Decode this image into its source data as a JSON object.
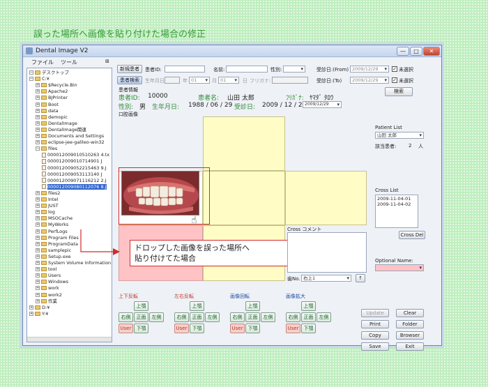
{
  "page_title": "誤った場所へ画像を貼り付けた場合の修正",
  "window": {
    "title": "Dental Image V2",
    "min": "—",
    "max": "□",
    "close": "✕"
  },
  "menu": [
    "ファイル",
    "ツール"
  ],
  "tree": [
    {
      "label": "デスクトップ",
      "depth": 0,
      "pm": "⊟",
      "type": "folder"
    },
    {
      "label": "C:¥",
      "depth": 0,
      "pm": "⊟",
      "type": "folder"
    },
    {
      "label": "$Recycle.Bin",
      "depth": 1,
      "pm": "⊞",
      "type": "folder"
    },
    {
      "label": "Apache2",
      "depth": 1,
      "pm": "⊞",
      "type": "folder"
    },
    {
      "label": "BJPrinter",
      "depth": 1,
      "pm": "⊞",
      "type": "folder"
    },
    {
      "label": "Boot",
      "depth": 1,
      "pm": "⊞",
      "type": "folder"
    },
    {
      "label": "data",
      "depth": 1,
      "pm": "⊞",
      "type": "folder"
    },
    {
      "label": "demopic",
      "depth": 1,
      "pm": "⊞",
      "type": "folder"
    },
    {
      "label": "DentalImage",
      "depth": 1,
      "pm": "⊞",
      "type": "folder"
    },
    {
      "label": "DentalImage関連",
      "depth": 1,
      "pm": "⊞",
      "type": "folder"
    },
    {
      "label": "Documents and Settings",
      "depth": 1,
      "pm": "⊞",
      "type": "folder"
    },
    {
      "label": "eclipse-jee-galileo-win32",
      "depth": 1,
      "pm": "⊞",
      "type": "folder"
    },
    {
      "label": "files",
      "depth": 1,
      "pm": "⊟",
      "type": "folder"
    },
    {
      "label": "000012009010510263 4.tx",
      "depth": 2,
      "pm": "",
      "type": "file"
    },
    {
      "label": "000012009010714901 J",
      "depth": 2,
      "pm": "",
      "type": "file"
    },
    {
      "label": "000012009052215463 9.J",
      "depth": 2,
      "pm": "",
      "type": "file"
    },
    {
      "label": "000012009053113140 J",
      "depth": 2,
      "pm": "",
      "type": "file"
    },
    {
      "label": "000012009071116212 2.J",
      "depth": 2,
      "pm": "",
      "type": "file"
    },
    {
      "label": "000012009080112076 8.J",
      "depth": 2,
      "pm": "",
      "type": "file",
      "selected": true
    },
    {
      "label": "files2",
      "depth": 1,
      "pm": "⊞",
      "type": "folder"
    },
    {
      "label": "Intel",
      "depth": 1,
      "pm": "⊞",
      "type": "folder"
    },
    {
      "label": "JUST",
      "depth": 1,
      "pm": "⊞",
      "type": "folder"
    },
    {
      "label": "log",
      "depth": 1,
      "pm": "⊞",
      "type": "folder"
    },
    {
      "label": "MSOCache",
      "depth": 1,
      "pm": "⊞",
      "type": "folder"
    },
    {
      "label": "MyWorks",
      "depth": 1,
      "pm": "⊞",
      "type": "folder"
    },
    {
      "label": "PerfLogs",
      "depth": 1,
      "pm": "⊞",
      "type": "folder"
    },
    {
      "label": "Program Files",
      "depth": 1,
      "pm": "⊞",
      "type": "folder"
    },
    {
      "label": "ProgramData",
      "depth": 1,
      "pm": "⊞",
      "type": "folder"
    },
    {
      "label": "samplepic",
      "depth": 1,
      "pm": "⊞",
      "type": "folder"
    },
    {
      "label": "Setup.exe",
      "depth": 1,
      "pm": "⊞",
      "type": "folder"
    },
    {
      "label": "System Volume Information",
      "depth": 1,
      "pm": "⊞",
      "type": "folder"
    },
    {
      "label": "tool",
      "depth": 1,
      "pm": "⊞",
      "type": "folder"
    },
    {
      "label": "Users",
      "depth": 1,
      "pm": "⊞",
      "type": "folder"
    },
    {
      "label": "Windows",
      "depth": 1,
      "pm": "⊞",
      "type": "folder"
    },
    {
      "label": "work",
      "depth": 1,
      "pm": "⊞",
      "type": "folder"
    },
    {
      "label": "work2",
      "depth": 1,
      "pm": "⊞",
      "type": "folder"
    },
    {
      "label": "作業",
      "depth": 1,
      "pm": "⊞",
      "type": "folder"
    },
    {
      "label": "D:¥",
      "depth": 0,
      "pm": "⊞",
      "type": "folder"
    },
    {
      "label": "Y:¥",
      "depth": 0,
      "pm": "⊞",
      "type": "folder"
    }
  ],
  "search": {
    "new_patient": "新規患者",
    "patient_id_label": "患者ID:",
    "name_label": "名前:",
    "sex_label": "性別:",
    "visit_from_label": "受診日:(From)",
    "visit_from_value": "2009/12/29",
    "unselected": "未選択",
    "search_patient": "患者検索",
    "birth_label": "生年月日:",
    "year": "年",
    "year_val": "01",
    "month": "月",
    "month_val": "01",
    "day": "日",
    "furigana_label": "フリガナ:",
    "visit_to_label": "受診日:(To)",
    "visit_to_value": "2009/12/29",
    "search_btn": "検索"
  },
  "patient": {
    "section": "患者情報",
    "id_label": "患者ID:",
    "id_value": "10000",
    "name_label": "患者名:",
    "name_value": "山田 太郎",
    "kana_label": "ﾌﾘｶﾞﾅ:",
    "kana_value": "ﾔﾏﾀﾞ ﾀﾛｳ",
    "sex_label": "性別:",
    "sex_value": "男",
    "birth_label": "生年月日:",
    "birth_value": "1988 / 06 / 29",
    "visit_label": "受診日:",
    "visit_value": "2009 / 12 / 29",
    "visit_select": "2009/12/29"
  },
  "oral_label": "口腔画像",
  "cross_comment_label": "Cross コメント",
  "callout": "ドロップした画像を誤った場所へ\n貼り付けてた場合",
  "tooth_no_label": "歯No.",
  "tooth_no_value": "右上1",
  "up_arrow": "↑",
  "patient_list": {
    "label": "Patient List",
    "value": "山田 太郎",
    "count_label": "該当患者:",
    "count_value": "2",
    "count_unit": "人"
  },
  "cross_list": {
    "label": "Cross List",
    "items": [
      "2009-11-04-01",
      "2009-11-04-02"
    ],
    "del": "Cross Del"
  },
  "optional_name_label": "Optional Name:",
  "groups": [
    {
      "label": "上下反転",
      "cls": "red"
    },
    {
      "label": "左右反転",
      "cls": "red"
    },
    {
      "label": "画像回転",
      "cls": "blue"
    },
    {
      "label": "画像拡大",
      "cls": "blue"
    }
  ],
  "pad": {
    "top": "上顎",
    "right": "右側",
    "front": "正面",
    "left": "左側",
    "user": "User",
    "bottom": "下顎"
  },
  "actions": {
    "update": "Update",
    "clear": "Clear",
    "print": "Print",
    "folder": "Folder",
    "copy": "Copy",
    "browser": "Browser",
    "save": "Save",
    "exit": "Exit"
  }
}
